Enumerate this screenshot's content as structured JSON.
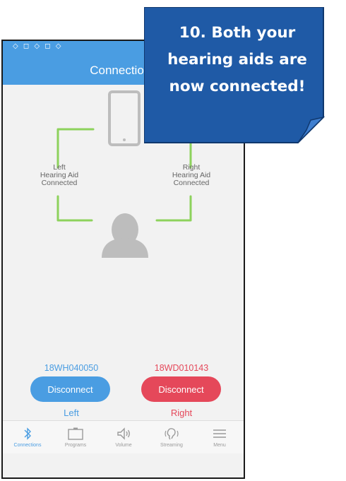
{
  "status_bar": {
    "icons_text": "◇ ◻ ◇ ◻ ◇"
  },
  "app": {
    "title": "Connections"
  },
  "diagram": {
    "left_label": [
      "Left",
      "Hearing Aid",
      "Connected"
    ],
    "right_label": [
      "Right",
      "Hearing Aid",
      "Connected"
    ],
    "link_color": "#8dd25c",
    "icon_color": "#bdbdbd"
  },
  "devices": {
    "left": {
      "serial": "18WH040050",
      "button_label": "Disconnect",
      "side_label": "Left",
      "color": "#4a9de2"
    },
    "right": {
      "serial": "18WD010143",
      "button_label": "Disconnect",
      "side_label": "Right",
      "color": "#e5485a"
    }
  },
  "nav": {
    "items": [
      {
        "label": "Connections",
        "icon": "bluetooth-icon",
        "active": true
      },
      {
        "label": "Programs",
        "icon": "programs-icon",
        "active": false
      },
      {
        "label": "Volume",
        "icon": "volume-icon",
        "active": false
      },
      {
        "label": "Streaming",
        "icon": "streaming-icon",
        "active": false
      },
      {
        "label": "Menu",
        "icon": "menu-icon",
        "active": false
      }
    ]
  },
  "callout": {
    "lines": [
      "10. Both your",
      "hearing aids are",
      "now connected!"
    ],
    "background": "#1f5aa6"
  }
}
